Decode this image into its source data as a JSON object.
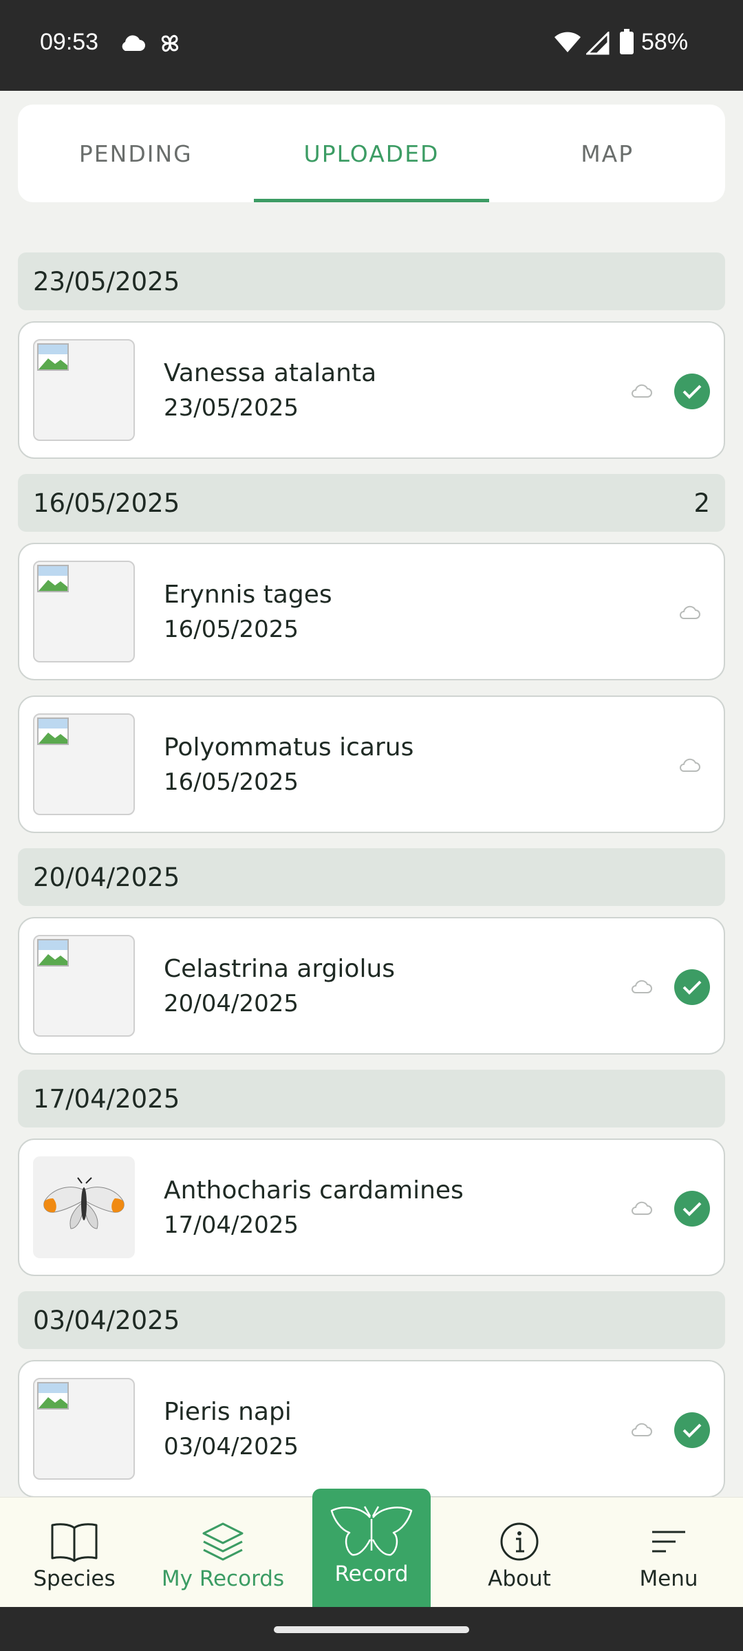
{
  "status_bar": {
    "time": "09:53",
    "battery_percent": "58%"
  },
  "tabs": [
    {
      "label": "PENDING",
      "active": false
    },
    {
      "label": "UPLOADED",
      "active": true
    },
    {
      "label": "MAP",
      "active": false
    }
  ],
  "groups": [
    {
      "date": "23/05/2025",
      "count": "",
      "records": [
        {
          "name": "Vanessa atalanta",
          "date": "23/05/2025",
          "verified": true,
          "has_photo": false
        }
      ]
    },
    {
      "date": "16/05/2025",
      "count": "2",
      "records": [
        {
          "name": "Erynnis tages",
          "date": "16/05/2025",
          "verified": false,
          "has_photo": false
        },
        {
          "name": "Polyommatus icarus",
          "date": "16/05/2025",
          "verified": false,
          "has_photo": false
        }
      ]
    },
    {
      "date": "20/04/2025",
      "count": "",
      "records": [
        {
          "name": "Celastrina argiolus",
          "date": "20/04/2025",
          "verified": true,
          "has_photo": false
        }
      ]
    },
    {
      "date": "17/04/2025",
      "count": "",
      "records": [
        {
          "name": "Anthocharis cardamines",
          "date": "17/04/2025",
          "verified": true,
          "has_photo": true
        }
      ]
    },
    {
      "date": "03/04/2025",
      "count": "",
      "records": [
        {
          "name": "Pieris napi",
          "date": "03/04/2025",
          "verified": true,
          "has_photo": false
        }
      ]
    }
  ],
  "bottom_nav": {
    "species": "Species",
    "my_records": "My Records",
    "record": "Record",
    "about": "About",
    "menu": "Menu"
  },
  "colors": {
    "accent": "#3c9c64",
    "group_header_bg": "#dfe5e0",
    "nav_bg": "#fbfbf0"
  }
}
